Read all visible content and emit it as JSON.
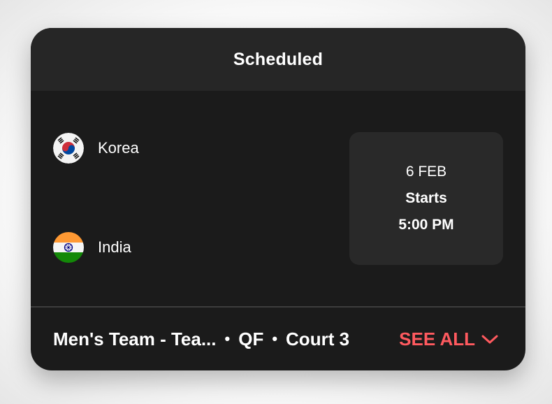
{
  "header": {
    "title": "Scheduled"
  },
  "teams": [
    {
      "name": "Korea",
      "flag_icon": "korea-flag-icon"
    },
    {
      "name": "India",
      "flag_icon": "india-flag-icon"
    }
  ],
  "schedule": {
    "date": "6 FEB",
    "label": "Starts",
    "time": "5:00 PM"
  },
  "footer": {
    "event": "Men's Team - Tea...",
    "round": "QF",
    "court": "Court 3",
    "separator": "•",
    "see_all_label": "SEE ALL"
  },
  "colors": {
    "accent": "#ff5a5f",
    "card_bg": "#1b1b1b",
    "header_bg": "#262626",
    "time_box_bg": "#292929"
  }
}
